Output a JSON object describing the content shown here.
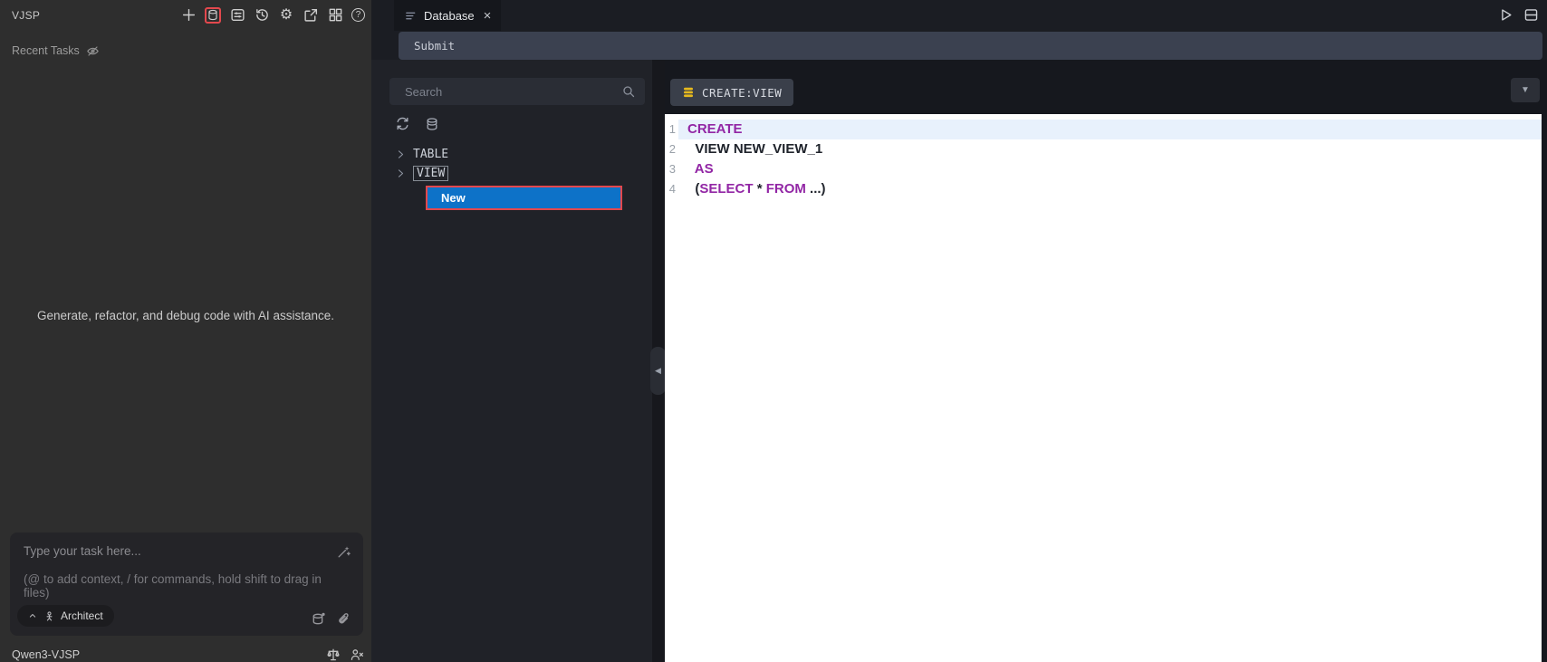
{
  "colors": {
    "accent_blue": "#0d72c8",
    "alert_red": "#e3484d",
    "keyword_purple": "#9226a5",
    "db_yellow": "#e6b91e"
  },
  "left_panel": {
    "title": "VJSP",
    "recent_tasks_label": "Recent Tasks",
    "empty_state": "Generate, refactor, and debug code with AI assistance.",
    "task_input": {
      "placeholder": "Type your task here...",
      "hint": "(@ to add context, / for commands, hold shift to drag in files)"
    },
    "mode_button": {
      "label": "Architect"
    },
    "model_label": "Qwen3-VJSP",
    "help_glyph": "?"
  },
  "db_panel": {
    "tab": {
      "label": "Database",
      "close_glyph": "×"
    },
    "submit_label": "Submit",
    "explorer": {
      "search_placeholder": "Search",
      "tree": {
        "table_label": "TABLE",
        "view_label": "VIEW",
        "new_item_label": "New"
      }
    },
    "editor": {
      "chip_label": "CREATE:VIEW",
      "dropdown_glyph": "▼",
      "collapse_glyph": "◀",
      "lines": [
        {
          "n": "1",
          "tokens": [
            {
              "t": "CREATE"
            }
          ]
        },
        {
          "n": "2",
          "tokens": [
            {
              "t": "  VIEW NEW_VIEW_1"
            }
          ]
        },
        {
          "n": "3",
          "tokens": [
            {
              "t": "  "
            },
            {
              "t": "AS"
            }
          ]
        },
        {
          "n": "4",
          "tokens": [
            {
              "t": "  ("
            },
            {
              "t": "SELECT"
            },
            {
              "t": " * "
            },
            {
              "t": "FROM"
            },
            {
              "t": " ...)"
            }
          ]
        }
      ]
    }
  }
}
